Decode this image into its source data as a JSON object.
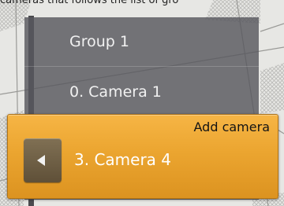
{
  "caption_fragment": "cameras that follows the list of gro",
  "camera_list": {
    "group_label": "Group 1",
    "camera_label": "0. Camera 1"
  },
  "add_camera": {
    "title": "Add camera",
    "selected_camera": "3. Camera 4",
    "back_icon": "chevron-left-icon"
  },
  "colors": {
    "panel": "#58585e",
    "accent": "#eba530",
    "back_button": "#6d5d44",
    "map_background": "#e7e7e4"
  }
}
